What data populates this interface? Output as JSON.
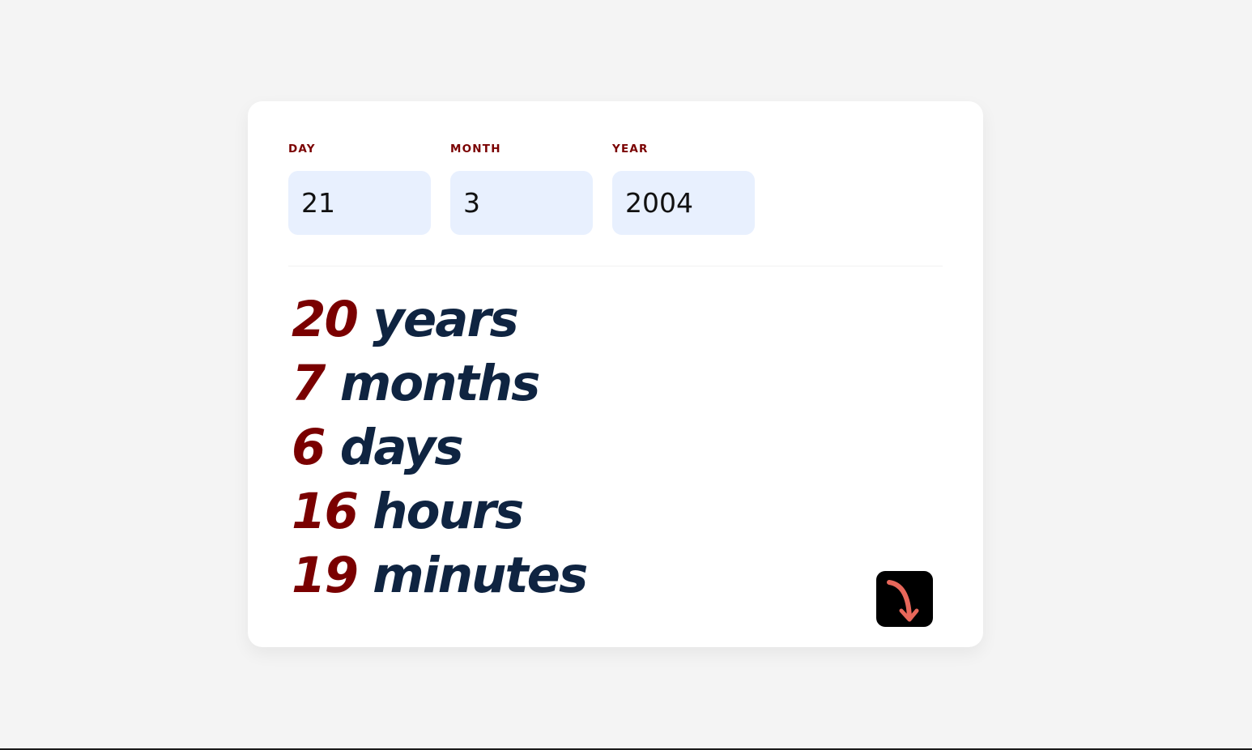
{
  "form": {
    "day": {
      "label": "DAY",
      "value": "21"
    },
    "month": {
      "label": "MONTH",
      "value": "3"
    },
    "year": {
      "label": "YEAR",
      "value": "2004"
    }
  },
  "results": [
    {
      "value": "20",
      "unit": "years"
    },
    {
      "value": "7",
      "unit": "months"
    },
    {
      "value": "6",
      "unit": "days"
    },
    {
      "value": "16",
      "unit": "hours"
    },
    {
      "value": "19",
      "unit": "minutes"
    }
  ],
  "submit": {
    "icon": "curved-arrow-down-icon"
  },
  "colors": {
    "background": "#f4f4f4",
    "card": "#ffffff",
    "label": "#7a0000",
    "input_bg": "#e8f0fe",
    "value": "#7a0000",
    "unit": "#0f2441",
    "button_bg": "#000000",
    "arrow": "#e8675a"
  }
}
